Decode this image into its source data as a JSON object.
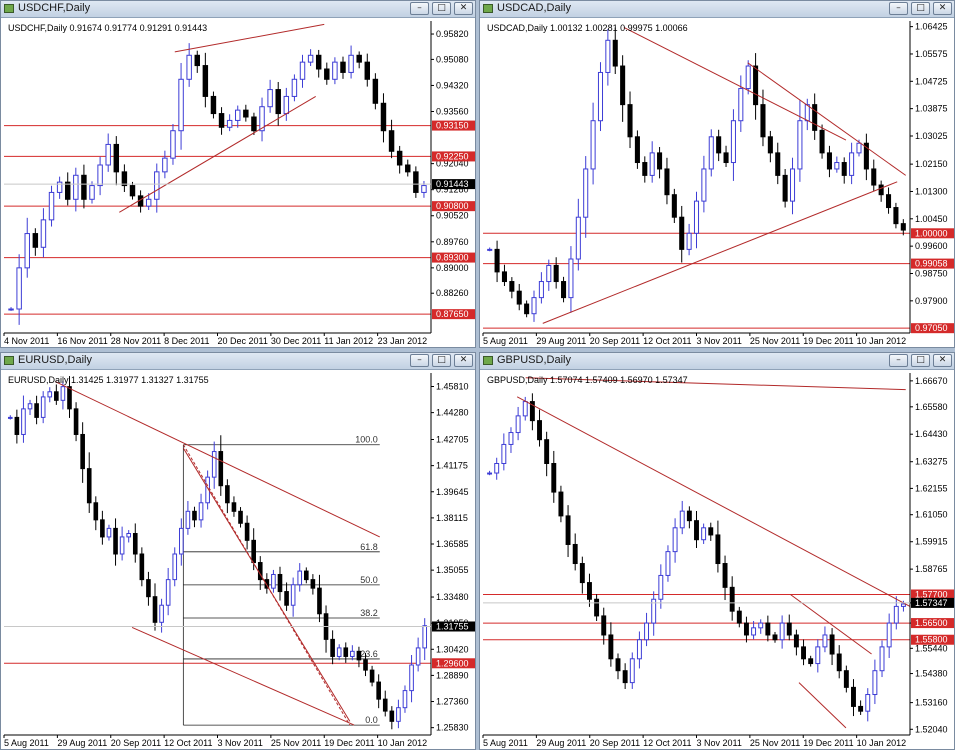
{
  "colors": {
    "up": "#3d3dd6",
    "down": "#000000",
    "level": "#d42a2a",
    "trend": "#b22a2a",
    "grid": "#000000"
  },
  "windows": [
    {
      "id": "usdchf",
      "title": "USDCHF,Daily",
      "ohlc": "USDCHF,Daily  0.91674 0.91774 0.91291 0.91443",
      "price_min": 0.871,
      "price_max": 0.962,
      "price_ticks": [
        "0.95820",
        "0.95080",
        "0.94320",
        "0.93560",
        "0.92040",
        "0.91280",
        "0.90520",
        "0.89760",
        "0.89000",
        "0.88260"
      ],
      "levels": [
        {
          "price": "0.93150",
          "value": 0.9315
        },
        {
          "price": "0.92250",
          "value": 0.9225
        },
        {
          "price": "0.90800",
          "value": 0.908
        },
        {
          "price": "0.89300",
          "value": 0.893
        },
        {
          "price": "0.87650",
          "value": 0.8765
        }
      ],
      "current": {
        "price": "0.91443",
        "value": 0.91443
      },
      "date_ticks": [
        "4 Nov 2011",
        "16 Nov 2011",
        "28 Nov 2011",
        "8 Dec 2011",
        "20 Dec 2011",
        "30 Dec 2011",
        "11 Jan 2012",
        "23 Jan 2012"
      ],
      "trendlines": [
        {
          "from": [
            0.27,
            0.9062
          ],
          "to": [
            0.73,
            0.94
          ]
        },
        {
          "from": [
            0.4,
            0.953
          ],
          "to": [
            0.75,
            0.961
          ]
        }
      ],
      "path": [
        0.878,
        0.89,
        0.9,
        0.896,
        0.904,
        0.912,
        0.915,
        0.91,
        0.917,
        0.91,
        0.914,
        0.92,
        0.926,
        0.918,
        0.914,
        0.911,
        0.908,
        0.91,
        0.918,
        0.922,
        0.93,
        0.945,
        0.952,
        0.949,
        0.94,
        0.935,
        0.931,
        0.933,
        0.936,
        0.934,
        0.93,
        0.937,
        0.942,
        0.935,
        0.94,
        0.945,
        0.95,
        0.952,
        0.948,
        0.945,
        0.95,
        0.947,
        0.952,
        0.95,
        0.945,
        0.938,
        0.93,
        0.924,
        0.92,
        0.918,
        0.912,
        0.914
      ]
    },
    {
      "id": "usdcad",
      "title": "USDCAD,Daily",
      "ohlc": "USDCAD,Daily  1.00132 1.00281 0.99975 1.00066",
      "price_min": 0.969,
      "price_max": 1.066,
      "price_ticks": [
        "1.06425",
        "1.05575",
        "1.04725",
        "1.03875",
        "1.03025",
        "1.02150",
        "1.01300",
        "1.00450",
        "0.99600",
        "0.98750",
        "0.97900"
      ],
      "levels": [
        {
          "price": "1.00000",
          "value": 1.0
        },
        {
          "price": "0.99058",
          "value": 0.99058
        },
        {
          "price": "0.97050",
          "value": 0.9705
        }
      ],
      "current": null,
      "date_ticks": [
        "5 Aug 2011",
        "29 Aug 2011",
        "20 Sep 2011",
        "12 Oct 2011",
        "3 Nov 2011",
        "25 Nov 2011",
        "19 Dec 2011",
        "10 Jan 2012"
      ],
      "trendlines": [
        {
          "from": [
            0.14,
            0.972
          ],
          "to": [
            0.97,
            1.016
          ]
        },
        {
          "from": [
            0.33,
            1.064
          ],
          "to": [
            0.85,
            1.029
          ]
        },
        {
          "from": [
            0.62,
            1.053
          ],
          "to": [
            0.99,
            1.018
          ]
        }
      ],
      "path": [
        0.995,
        0.988,
        0.985,
        0.982,
        0.978,
        0.975,
        0.98,
        0.985,
        0.99,
        0.985,
        0.98,
        0.992,
        1.005,
        1.02,
        1.035,
        1.05,
        1.06,
        1.052,
        1.04,
        1.03,
        1.022,
        1.018,
        1.025,
        1.02,
        1.012,
        1.005,
        0.995,
        1.0,
        1.01,
        1.02,
        1.03,
        1.025,
        1.022,
        1.035,
        1.045,
        1.052,
        1.04,
        1.03,
        1.025,
        1.018,
        1.01,
        1.02,
        1.035,
        1.04,
        1.032,
        1.025,
        1.02,
        1.022,
        1.018,
        1.025,
        1.028,
        1.02,
        1.015,
        1.012,
        1.008,
        1.003,
        1.001
      ]
    },
    {
      "id": "eurusd",
      "title": "EURUSD,Daily",
      "ohlc": "EURUSD,Daily  1.31425 1.31977 1.31327 1.31755",
      "price_min": 1.254,
      "price_max": 1.466,
      "price_ticks": [
        "1.45810",
        "1.44280",
        "1.42705",
        "1.41175",
        "1.39645",
        "1.38115",
        "1.36585",
        "1.35055",
        "1.33480",
        "1.31950",
        "1.30420",
        "1.28890",
        "1.27360",
        "1.25830"
      ],
      "levels": [
        {
          "price": "1.29600",
          "value": 1.296
        }
      ],
      "current": {
        "price": "1.31755",
        "value": 1.31755
      },
      "date_ticks": [
        "5 Aug 2011",
        "29 Aug 2011",
        "20 Sep 2011",
        "12 Oct 2011",
        "3 Nov 2011",
        "25 Nov 2011",
        "19 Dec 2011",
        "10 Jan 2012"
      ],
      "fib": {
        "high": 1.424,
        "low": 1.2598,
        "x_start": 0.42,
        "x_end": 0.88,
        "labels": [
          "100.0",
          "61.8",
          "50.0",
          "38.2",
          "23.6",
          "0.0"
        ],
        "ratios": [
          1.0,
          0.618,
          0.5,
          0.382,
          0.236,
          0.0
        ]
      },
      "trendlines": [
        {
          "from": [
            0.12,
            1.461
          ],
          "to": [
            0.88,
            1.37
          ]
        },
        {
          "from": [
            0.3,
            1.317
          ],
          "to": [
            0.82,
            1.2598
          ]
        },
        {
          "from": [
            0.42,
            1.422
          ],
          "to": [
            0.81,
            1.262
          ]
        }
      ],
      "path": [
        1.44,
        1.43,
        1.445,
        1.448,
        1.44,
        1.452,
        1.455,
        1.45,
        1.458,
        1.445,
        1.43,
        1.41,
        1.39,
        1.38,
        1.37,
        1.375,
        1.36,
        1.37,
        1.372,
        1.36,
        1.345,
        1.335,
        1.32,
        1.33,
        1.345,
        1.36,
        1.375,
        1.385,
        1.38,
        1.39,
        1.405,
        1.42,
        1.4,
        1.39,
        1.385,
        1.378,
        1.368,
        1.355,
        1.345,
        1.34,
        1.348,
        1.338,
        1.33,
        1.342,
        1.35,
        1.345,
        1.34,
        1.325,
        1.31,
        1.3,
        1.305,
        1.3,
        1.303,
        1.298,
        1.292,
        1.285,
        1.275,
        1.268,
        1.262,
        1.27,
        1.28,
        1.295,
        1.305,
        1.318
      ]
    },
    {
      "id": "gbpusd",
      "title": "GBPUSD,Daily",
      "ohlc": "GBPUSD,Daily  1.57074 1.57409 1.56970 1.57347",
      "price_min": 1.518,
      "price_max": 1.67,
      "price_ticks": [
        "1.66670",
        "1.65580",
        "1.64430",
        "1.63275",
        "1.62155",
        "1.61050",
        "1.59915",
        "1.58765",
        "1.57347",
        "1.56500",
        "1.55440",
        "1.54380",
        "1.53160",
        "1.52040"
      ],
      "levels": [
        {
          "price": "1.57700",
          "value": 1.577
        },
        {
          "price": "1.56500",
          "value": 1.565
        },
        {
          "price": "1.55800",
          "value": 1.558
        }
      ],
      "current": {
        "price": "1.57347",
        "value": 1.57347
      },
      "date_ticks": [
        "5 Aug 2011",
        "29 Aug 2011",
        "20 Sep 2011",
        "12 Oct 2011",
        "3 Nov 2011",
        "25 Nov 2011",
        "19 Dec 2011",
        "10 Jan 2012"
      ],
      "trendlines": [
        {
          "from": [
            0.08,
            1.66
          ],
          "to": [
            1.0,
            1.572
          ]
        },
        {
          "from": [
            0.1,
            1.668
          ],
          "to": [
            0.99,
            1.663
          ]
        },
        {
          "from": [
            0.72,
            1.577
          ],
          "to": [
            0.91,
            1.552
          ]
        },
        {
          "from": [
            0.74,
            1.54
          ],
          "to": [
            0.85,
            1.521
          ]
        }
      ],
      "path": [
        1.628,
        1.632,
        1.64,
        1.645,
        1.652,
        1.658,
        1.65,
        1.642,
        1.632,
        1.62,
        1.61,
        1.598,
        1.59,
        1.582,
        1.575,
        1.568,
        1.56,
        1.55,
        1.545,
        1.54,
        1.55,
        1.558,
        1.565,
        1.575,
        1.585,
        1.595,
        1.605,
        1.612,
        1.608,
        1.6,
        1.605,
        1.602,
        1.59,
        1.58,
        1.57,
        1.565,
        1.56,
        1.563,
        1.565,
        1.56,
        1.558,
        1.565,
        1.56,
        1.555,
        1.55,
        1.548,
        1.555,
        1.56,
        1.552,
        1.545,
        1.538,
        1.53,
        1.528,
        1.535,
        1.545,
        1.555,
        1.565,
        1.572,
        1.573
      ]
    }
  ]
}
